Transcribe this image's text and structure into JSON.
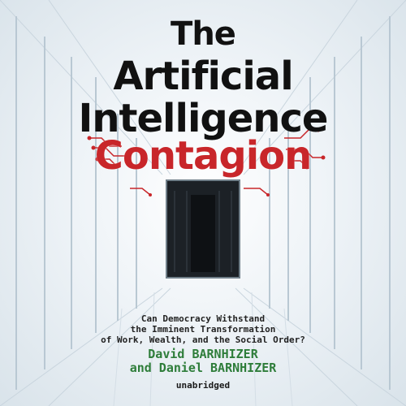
{
  "cover": {
    "title_lines": [
      "The",
      "Artificial",
      "Intelligence",
      "Contagion"
    ],
    "subtitle_lines": [
      "Can Democracy Withstand",
      "the Imminent Transformation",
      "of Work, Wealth, and the Social Order?"
    ],
    "authors": [
      "David BARNHIZER",
      "and Daniel BARNHIZER"
    ],
    "edition": "unabridged",
    "colors": {
      "title": "#111111",
      "accent_title": "#c8262a",
      "authors": "#2e7d3a",
      "circuit": "#c8262a"
    }
  }
}
